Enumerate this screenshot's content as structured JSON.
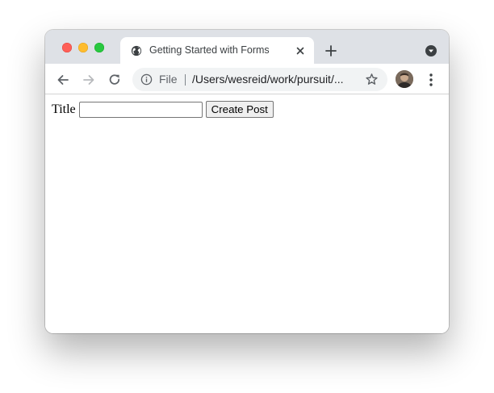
{
  "window": {
    "tab": {
      "title": "Getting Started with Forms"
    },
    "omnibox": {
      "scheme_label": "File",
      "url": "/Users/wesreid/work/pursuit/..."
    }
  },
  "page": {
    "form": {
      "title_label": "Title",
      "title_value": "",
      "submit_label": "Create Post"
    }
  },
  "icons": {
    "favicon": "globe-icon",
    "tab_close": "close-icon",
    "new_tab": "plus-icon",
    "tab_search": "chevron-down-circle-icon",
    "back": "arrow-left-icon",
    "forward": "arrow-right-icon",
    "reload": "reload-icon",
    "site_info": "info-icon",
    "bookmark": "star-icon",
    "profile": "avatar",
    "menu": "more-vertical-icon"
  },
  "colors": {
    "tabstrip_bg": "#dee1e6",
    "omnibox_bg": "#f1f3f4",
    "traffic_red": "#fe5f57",
    "traffic_yellow": "#febc2e",
    "traffic_green": "#28c840"
  }
}
